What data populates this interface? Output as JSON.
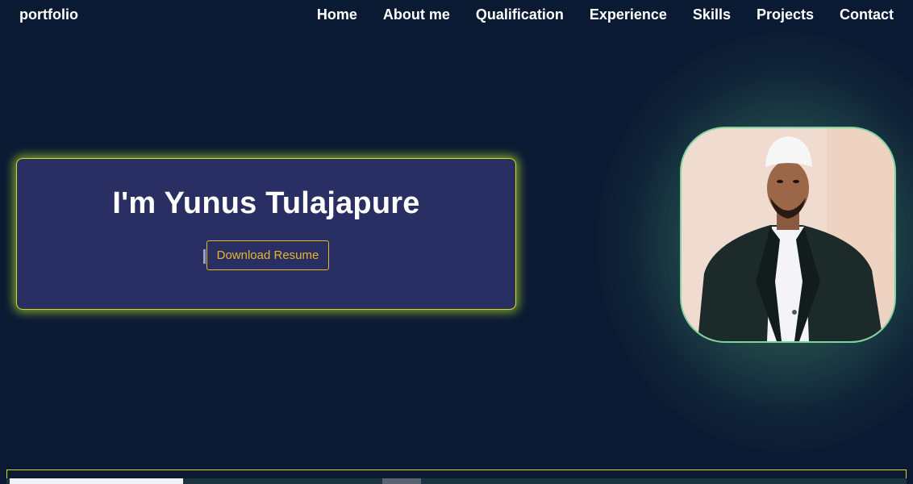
{
  "brand": "portfolio",
  "nav": {
    "items": [
      {
        "label": "Home"
      },
      {
        "label": "About me"
      },
      {
        "label": "Qualification"
      },
      {
        "label": "Experience"
      },
      {
        "label": "Skills"
      },
      {
        "label": "Projects"
      },
      {
        "label": "Contact"
      }
    ]
  },
  "hero": {
    "title": "I'm Yunus Tulajapure",
    "download_label": "Download Resume"
  },
  "colors": {
    "background": "#0b1a33",
    "card": "#2a2f63",
    "card_border": "#d4d628",
    "button_accent": "#e8b52a",
    "photo_border": "#7fd39e"
  }
}
